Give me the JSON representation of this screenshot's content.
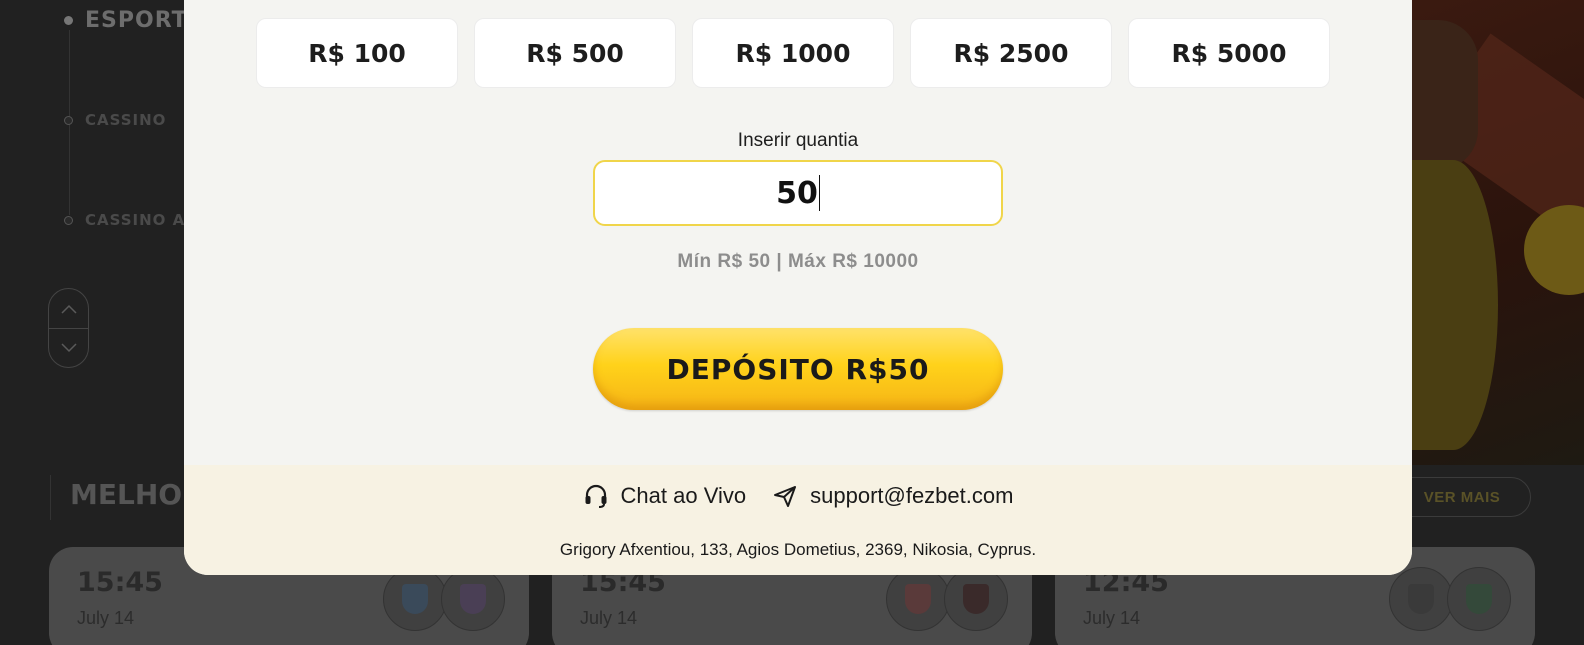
{
  "background": {
    "nav": {
      "items": [
        {
          "label": "ESPORTE"
        },
        {
          "label": "CASSINO"
        },
        {
          "label": "CASSINO AO VIVO"
        }
      ]
    },
    "section_title": "MELHORES",
    "see_more_label": "VER MAIS",
    "matches": [
      {
        "time": "15:45",
        "date": "July 14"
      },
      {
        "time": "15:45",
        "date": "July 14"
      },
      {
        "time": "12:45",
        "date": "July 14"
      }
    ]
  },
  "modal": {
    "preset_amounts": [
      "R$ 100",
      "R$ 500",
      "R$ 1000",
      "R$ 2500",
      "R$ 5000"
    ],
    "input_label": "Inserir quantia",
    "input_value": "50",
    "limits_text": "Mín R$ 50 | Máx R$ 10000",
    "deposit_label": "DEPÓSITO R$50",
    "footer": {
      "chat_label": "Chat ao Vivo",
      "support_email": "support@fezbet.com",
      "address": "Grigory Afxentiou, 133, Agios Dometius, 2369, Nikosia, Cyprus."
    }
  },
  "colors": {
    "accent": "#ffd21a",
    "input_border": "#f0d54a",
    "modal_bg": "#f4f4f1",
    "footer_bg": "#f7f2e3"
  }
}
